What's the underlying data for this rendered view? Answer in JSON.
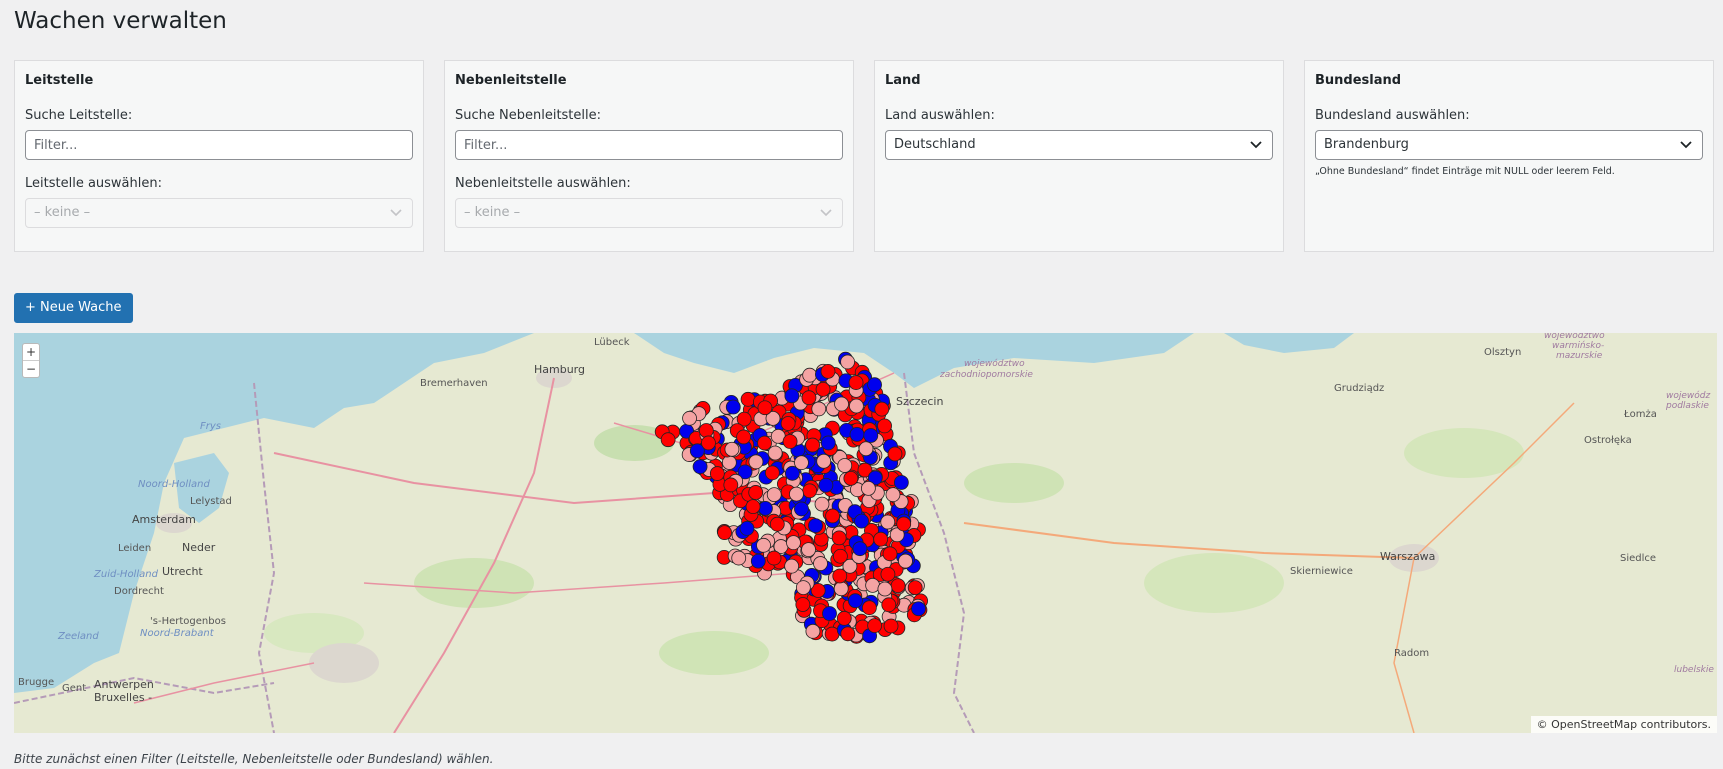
{
  "page": {
    "title": "Wachen verwalten"
  },
  "filters": {
    "leitstelle": {
      "title": "Leitstelle",
      "search_label": "Suche Leitstelle:",
      "search_placeholder": "Filter...",
      "select_label": "Leitstelle auswählen:",
      "select_value": "– keine –"
    },
    "nebenleitstelle": {
      "title": "Nebenleitstelle",
      "search_label": "Suche Nebenleitstelle:",
      "search_placeholder": "Filter...",
      "select_label": "Nebenleitstelle auswählen:",
      "select_value": "– keine –"
    },
    "land": {
      "title": "Land",
      "select_label": "Land auswählen:",
      "select_value": "Deutschland"
    },
    "bundesland": {
      "title": "Bundesland",
      "select_label": "Bundesland auswählen:",
      "select_value": "Brandenburg",
      "hint": "„Ohne Bundesland“ findet Einträge mit NULL oder leerem Feld."
    }
  },
  "actions": {
    "new_station": "+ Neue Wache"
  },
  "map": {
    "zoom_in": "+",
    "zoom_out": "−",
    "attribution": "© OpenStreetMap contributors.",
    "labels": {
      "hamburg": "Hamburg",
      "lubeck": "Lübeck",
      "bremerhaven": "Bremerhaven",
      "szczecin": "Szczecin",
      "amsterdam": "Amsterdam",
      "lelystad": "Lelystad",
      "leiden": "Leiden",
      "utrecht": "Utrecht",
      "dordrecht": "Dordrecht",
      "hertogenbos": "'s-Hertogenbos",
      "antwerpen": "Antwerpen",
      "bruxelles": "Bruxelles -",
      "brugge": "Brugge",
      "gent": "Gent",
      "nederland": "Neder",
      "warszawa": "Warszawa",
      "grudziadz": "Grudziądz",
      "olsztyn": "Olsztyn",
      "lomza": "Łomża",
      "ostroleka": "Ostrołęka",
      "siedlce": "Siedlce",
      "skierniewice": "Skierniewice",
      "radom": "Radom",
      "frys": "Frys",
      "noord_holland": "Noord-Holland",
      "zuid_holland": "Zuid-Holland",
      "zeeland": "Zeeland",
      "noord_brabant": "Noord-Brabant",
      "zachodniopomorskie_1": "województwo",
      "zachodniopomorskie_2": "zachodniopomorskie",
      "warminsko_1": "województwo",
      "warminsko_2": "warmińsko-",
      "warminsko_3": "mazurskie",
      "podlaskie_1": "wojewódz",
      "podlaskie_2": "podlaskie",
      "lubelskie": "lubelskie"
    },
    "marker_colors": {
      "red": "#ff0000",
      "pink": "#f4a3a3",
      "blue": "#0000ee"
    }
  },
  "footnote": "Bitte zunächst einen Filter (Leitstelle, Nebenleitstelle oder Bundesland) wählen."
}
